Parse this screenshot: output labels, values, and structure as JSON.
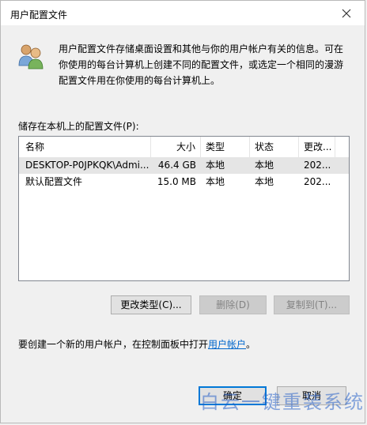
{
  "window": {
    "title": "用户配置文件"
  },
  "intro": {
    "line1": "用户配置文件存储桌面设置和其他与你的用户帐户有关的信息。可在",
    "line2": "你使用的每台计算机上创建不同的配置文件，或选定一个相同的漫游",
    "line3": "配置文件用在你使用的每台计算机上。"
  },
  "list_label": "储存在本机上的配置文件(P):",
  "columns": {
    "name": "名称",
    "size": "大小",
    "type": "类型",
    "status": "状态",
    "modified": "更改..."
  },
  "rows": [
    {
      "name": "DESKTOP-P0JPKQK\\Admi...",
      "size": "46.4 GB",
      "type": "本地",
      "status": "本地",
      "modified": "202..."
    },
    {
      "name": "默认配置文件",
      "size": "15.0 MB",
      "type": "本地",
      "status": "本地",
      "modified": "202..."
    }
  ],
  "buttons": {
    "change_type": "更改类型(C)...",
    "delete": "删除(D)",
    "copy_to": "复制到(T)...",
    "ok": "确定",
    "cancel": "取消"
  },
  "footer": {
    "text": "要创建一个新的用户帐户，在控制面板中打开",
    "link": "用户帐户",
    "suffix": "。"
  },
  "watermark": "白云一键重装系统",
  "colors": {
    "link": "#0066cc",
    "primary_border": "#0078d7",
    "selected_row": "#e5e5e5"
  },
  "icons": {
    "close": "close-icon",
    "users": "users-icon"
  }
}
